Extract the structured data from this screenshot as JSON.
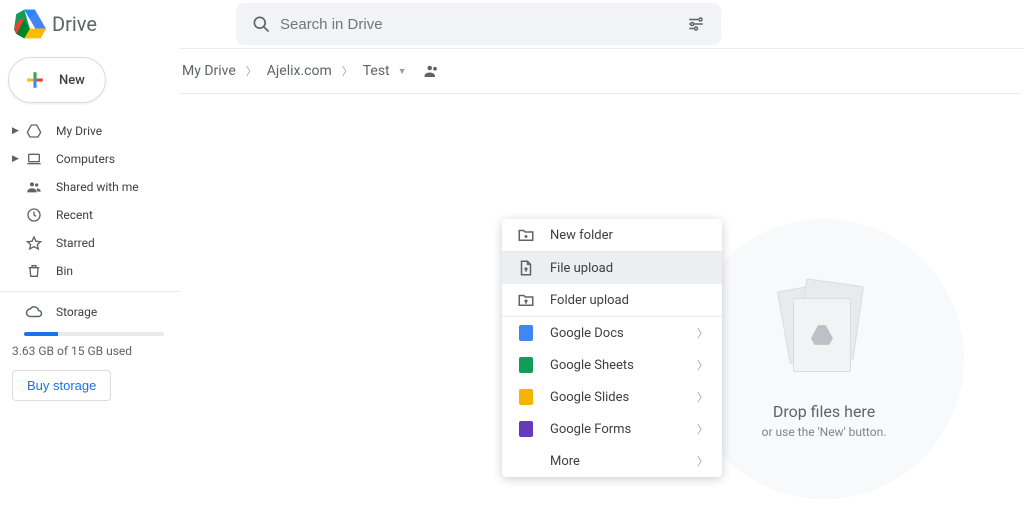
{
  "header": {
    "app_name": "Drive",
    "search_placeholder": "Search in Drive"
  },
  "sidebar": {
    "new_label": "New",
    "items": [
      {
        "label": "My Drive",
        "icon": "drive"
      },
      {
        "label": "Computers",
        "icon": "laptop"
      },
      {
        "label": "Shared with me",
        "icon": "people"
      },
      {
        "label": "Recent",
        "icon": "clock"
      },
      {
        "label": "Starred",
        "icon": "star"
      },
      {
        "label": "Bin",
        "icon": "trash"
      }
    ],
    "storage_label": "Storage",
    "storage_used_text": "3.63 GB of 15 GB used",
    "storage_pct": 24,
    "buy_label": "Buy storage"
  },
  "breadcrumbs": [
    "My Drive",
    "Ajelix.com",
    "Test"
  ],
  "drop": {
    "title": "Drop files here",
    "subtitle": "or use the 'New' button."
  },
  "context_menu": {
    "items": [
      {
        "label": "New folder",
        "icon": "folder-plus",
        "sep_after": true
      },
      {
        "label": "File upload",
        "icon": "file-upload",
        "highlighted": true
      },
      {
        "label": "Folder upload",
        "icon": "folder-upload",
        "sep_after": true
      },
      {
        "label": "Google Docs",
        "icon": "docs",
        "caret": true
      },
      {
        "label": "Google Sheets",
        "icon": "sheets",
        "caret": true
      },
      {
        "label": "Google Slides",
        "icon": "slides",
        "caret": true
      },
      {
        "label": "Google Forms",
        "icon": "forms",
        "caret": true
      },
      {
        "label": "More",
        "icon": "",
        "caret": true
      }
    ]
  }
}
